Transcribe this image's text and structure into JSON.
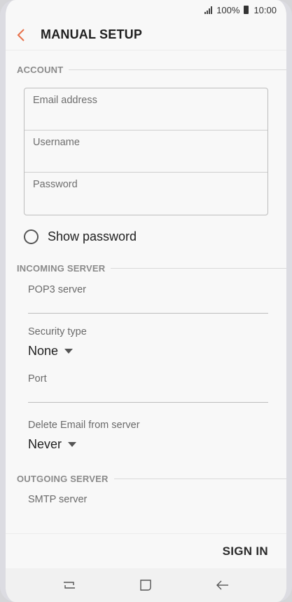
{
  "status_bar": {
    "battery": "100%",
    "time": "10:00"
  },
  "header": {
    "title": "MANUAL SETUP",
    "back_icon": "chevron-left-icon",
    "accent": "#e8714a"
  },
  "account": {
    "section_label": "ACCOUNT",
    "fields": [
      {
        "label": "Email address",
        "value": ""
      },
      {
        "label": "Username",
        "value": ""
      },
      {
        "label": "Password",
        "value": ""
      }
    ],
    "show_password": {
      "label": "Show password",
      "checked": false
    }
  },
  "incoming": {
    "section_label": "INCOMING SERVER",
    "server_label": "POP3 server",
    "server_value": "",
    "security_label": "Security type",
    "security_value": "None",
    "port_label": "Port",
    "port_value": "",
    "delete_label": "Delete Email from server",
    "delete_value": "Never"
  },
  "outgoing": {
    "section_label": "OUTGOING SERVER",
    "server_label": "SMTP server"
  },
  "footer": {
    "sign_in": "SIGN IN"
  },
  "nav": {
    "recent": "recent-apps-icon",
    "home": "home-icon",
    "back": "back-arrow-icon"
  }
}
